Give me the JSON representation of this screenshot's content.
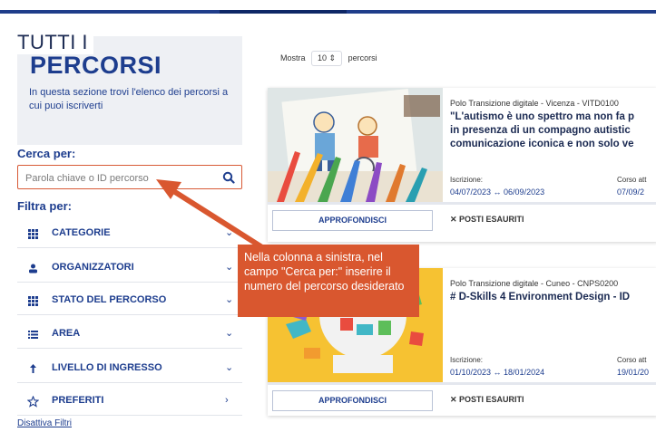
{
  "header": {
    "accent_color": "#1f3d8a"
  },
  "left": {
    "title_line1": "TUTTI I",
    "title_line2": "PERCORSI",
    "description": "In questa sezione trovi l'elenco dei percorsi a cui puoi iscriverti",
    "search_label": "Cerca per:",
    "search_placeholder": "Parola chiave o ID percorso",
    "filter_label": "Filtra per:",
    "filters": [
      {
        "label": "CATEGORIE",
        "icon": "grid-icon"
      },
      {
        "label": "ORGANIZZATORI",
        "icon": "users-icon"
      },
      {
        "label": "STATO DEL PERCORSO",
        "icon": "grid-icon"
      },
      {
        "label": "AREA",
        "icon": "list-icon"
      },
      {
        "label": "LIVELLO DI INGRESSO",
        "icon": "arrow-up-icon"
      },
      {
        "label": "PREFERITI",
        "icon": "star-icon"
      }
    ],
    "disable_filters": "Disattiva Filtri"
  },
  "main": {
    "mostra_prefix": "Mostra",
    "mostra_value": "10",
    "mostra_suffix": "percorsi",
    "cards": [
      {
        "pre": "Polo Transizione digitale - Vicenza - VITD0100",
        "title_lines": [
          "\"L'autismo è uno spettro ma non fa p",
          "in presenza di un compagno autistic",
          "comunicazione iconica e non solo ve"
        ],
        "iscrizione_label": "Iscrizione:",
        "iscrizione_value": "04/07/2023 ↔ 06/09/2023",
        "corso_label": "Corso att",
        "corso_value": "07/09/2",
        "button": "APPROFONDISCI",
        "status": "✕  POSTI ESAURITI"
      },
      {
        "pre": "Polo Transizione digitale - Cuneo - CNPS0200",
        "title_lines": [
          "# D-Skills 4 Environment Design - ID"
        ],
        "iscrizione_label": "Iscrizione:",
        "iscrizione_value": "01/10/2023 ↔ 18/01/2024",
        "corso_label": "Corso att",
        "corso_value": "19/01/20",
        "button": "APPROFONDISCI",
        "status": "✕  POSTI ESAURITI"
      }
    ]
  },
  "callout": {
    "text": "Nella colonna a sinistra, nel campo \"Cerca per:\" inserire il numero del percorso desiderato",
    "color": "#d9572f"
  }
}
